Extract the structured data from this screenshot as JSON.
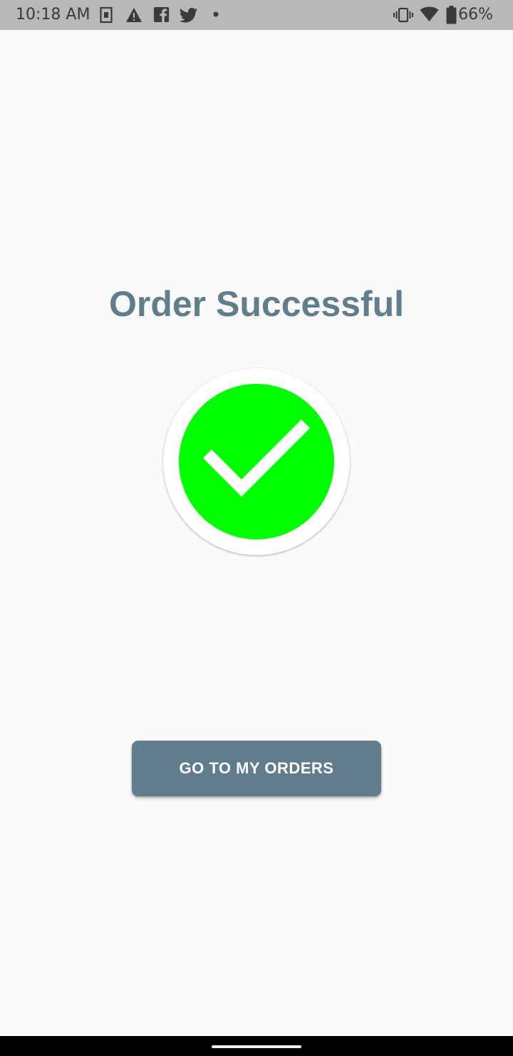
{
  "status_bar": {
    "time": "10:18 AM",
    "battery_percent": "66%",
    "icons": [
      "sim-card-icon",
      "warning-icon",
      "facebook-icon",
      "twitter-icon",
      "notification-dot-icon",
      "vibrate-icon",
      "wifi-icon",
      "battery-icon"
    ],
    "battery_level": 0.66
  },
  "main": {
    "title": "Order Successful",
    "success_icon": "checkmark-icon",
    "colors": {
      "accent": "#607d8b",
      "success": "#00ff00",
      "background": "#fafafa"
    }
  },
  "actions": {
    "orders_button_label": "GO TO MY ORDERS"
  }
}
